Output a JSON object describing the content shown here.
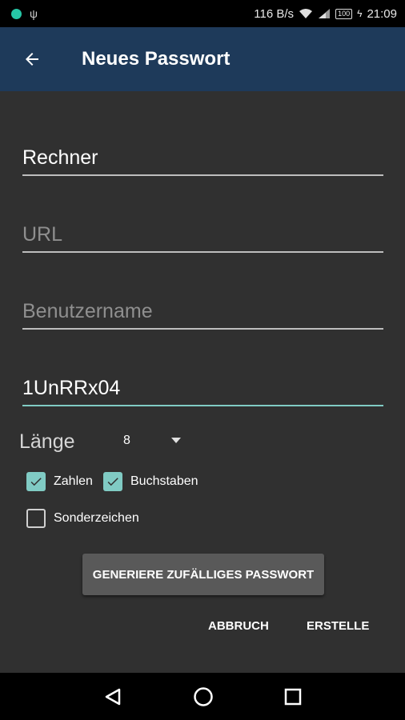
{
  "status_bar": {
    "speed": "116 B/s",
    "battery": "100",
    "time": "21:09",
    "icons": [
      "app-notification-icon",
      "usb-icon",
      "wifi-icon",
      "signal-icon",
      "battery-icon"
    ]
  },
  "app_bar": {
    "title": "Neues Passwort",
    "back_icon": "arrow-back-icon",
    "color": "#1e3a5a"
  },
  "form": {
    "name": {
      "value": "Rechner",
      "placeholder": ""
    },
    "url": {
      "value": "",
      "placeholder": "URL"
    },
    "username": {
      "value": "",
      "placeholder": "Benutzername"
    },
    "password": {
      "value": "1UnRRx04",
      "placeholder": ""
    },
    "length_label": "Länge",
    "length_value": "8",
    "options": {
      "numbers": {
        "label": "Zahlen",
        "checked": true
      },
      "letters": {
        "label": "Buchstaben",
        "checked": true
      },
      "special": {
        "label": "Sonderzeichen",
        "checked": false
      }
    },
    "generate_label": "GENERIERE ZUFÄLLIGES PASSWORT",
    "cancel_label": "ABBRUCH",
    "create_label": "ERSTELLE"
  },
  "colors": {
    "accent": "#80cbc4",
    "background": "#303030"
  },
  "nav_bar": {
    "icons": [
      "back-triangle-icon",
      "home-circle-icon",
      "recents-square-icon"
    ]
  }
}
